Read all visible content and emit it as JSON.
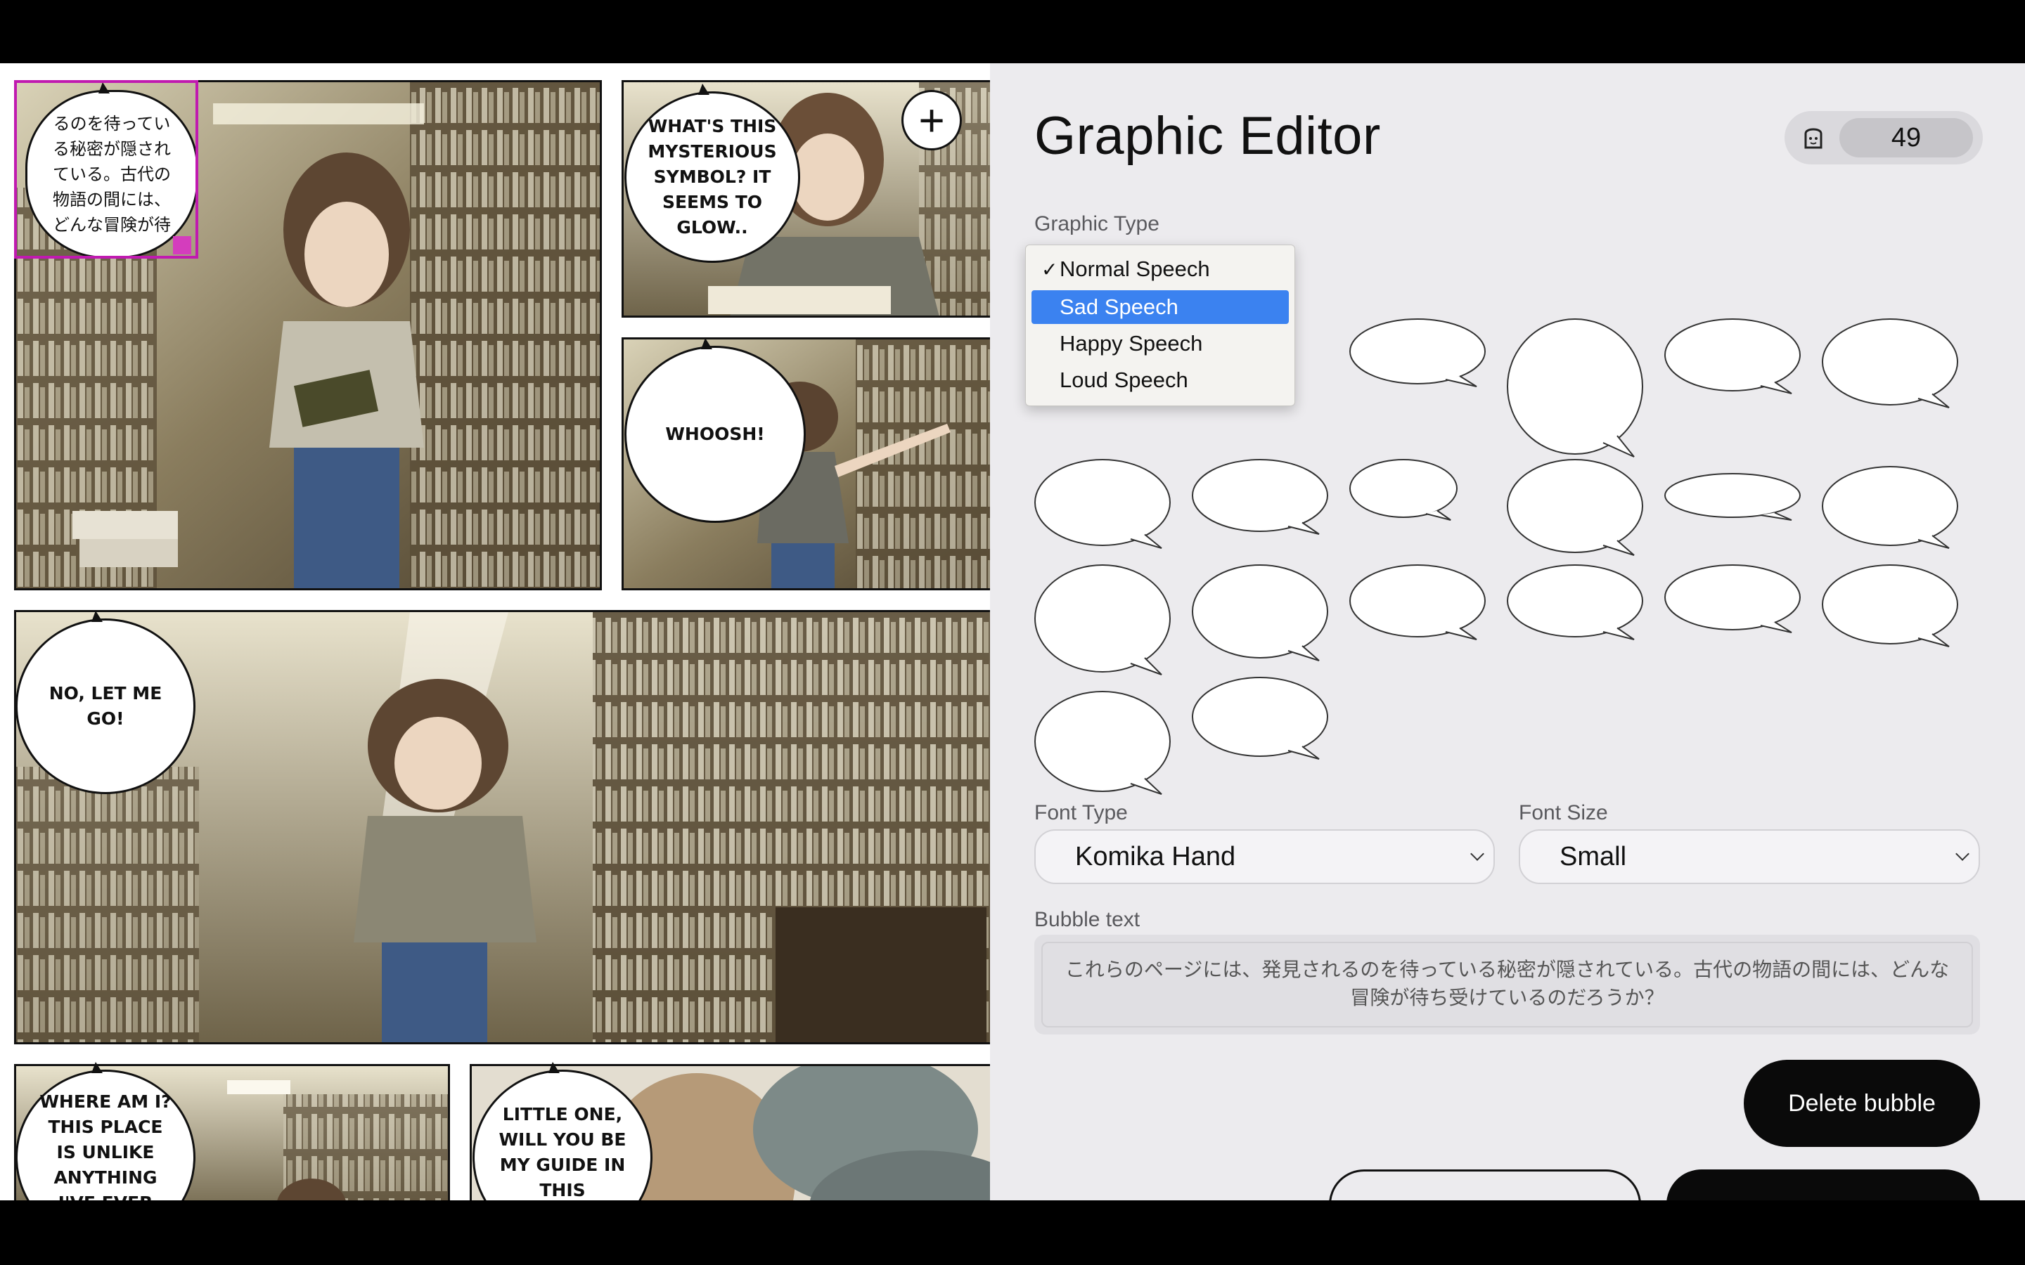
{
  "editor": {
    "title": "Graphic Editor",
    "credits": "49",
    "graphic_type_label": "Graphic Type",
    "graphic_type_options": [
      "Normal Speech",
      "Sad Speech",
      "Happy Speech",
      "Loud Speech"
    ],
    "graphic_type_selected": "Normal Speech",
    "graphic_type_highlighted": "Sad Speech",
    "font_type_label": "Font Type",
    "font_type_value": "Komika Hand",
    "font_size_label": "Font Size",
    "font_size_value": "Small",
    "bubble_text_label": "Bubble text",
    "bubble_text_value": "これらのページには、発見されるのを待っている秘密が隠されている。古代の物語の間には、どんな冒険が待ち受けているのだろうか？",
    "delete_button": "Delete bubble",
    "icons": {
      "credits": "toast-icon",
      "add": "plus-icon",
      "check": "checkmark-icon"
    }
  },
  "comic": {
    "bubbles": [
      {
        "text": "るのを待ってい\nる秘密が隠され\nている。古代の\n物語の間には、\nどんな冒険が待"
      },
      {
        "text": "What's this\nmysterious\nsymbol? It\nseems to\nglow.."
      },
      {
        "text": "Whoosh!"
      },
      {
        "text": "No, let me\ngo!"
      },
      {
        "text": "Where am I?\nThis place\nis unlike\nanything\nI've ever"
      },
      {
        "text": "Little one,\nwill you be\nmy guide in\nthis"
      }
    ]
  }
}
